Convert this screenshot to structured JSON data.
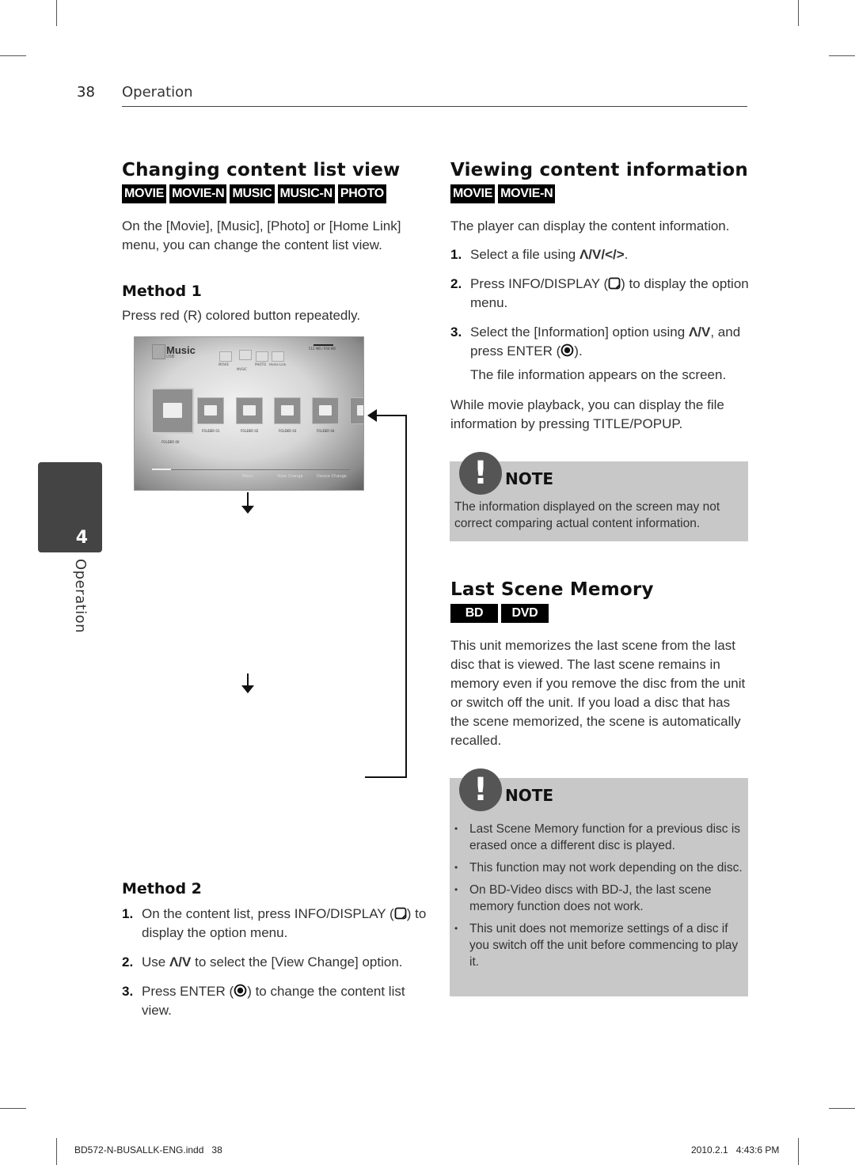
{
  "header": {
    "page_number": "38",
    "section": "Operation"
  },
  "side_tab": {
    "chapter_number": "4",
    "label": "Operation"
  },
  "left": {
    "title": "Changing content list view",
    "badges": [
      "MOVIE",
      "MOVIE-N",
      "MUSIC",
      "MUSIC-N",
      "PHOTO"
    ],
    "intro": "On the [Movie], [Music], [Photo] or [Home Link] menu, you can change the content list view.",
    "method1": {
      "heading": "Method 1",
      "text": "Press red (R) colored button repeatedly."
    },
    "screenshot": {
      "title": "Music",
      "subtitle": "USB",
      "categories": [
        "MOVIE",
        "MUSIC",
        "PHOTO",
        "Home Link"
      ],
      "capacity": "512 MB / 958 MB",
      "folders": [
        "FOLDER 00",
        "FOLDER 01",
        "FOLDER 02",
        "FOLDER 03",
        "FOLDER 04"
      ],
      "hints": [
        "Menu",
        "View Change",
        "Device Change"
      ]
    },
    "method2": {
      "heading": "Method 2",
      "steps": [
        {
          "num": "1.",
          "pre": "On the content list, press INFO/DISPLAY (",
          "post": ") to display the option menu."
        },
        {
          "num": "2.",
          "pre": "Use ",
          "keys": "Λ/V",
          "post": " to select the [View Change] option."
        },
        {
          "num": "3.",
          "pre": "Press ENTER (",
          "post": ") to change the content list view."
        }
      ]
    }
  },
  "right": {
    "info": {
      "title": "Viewing content information",
      "badges": [
        "MOVIE",
        "MOVIE-N"
      ],
      "intro": "The player can display the content information.",
      "steps": [
        {
          "num": "1.",
          "pre": "Select a file using ",
          "keys": "Λ/V/</>",
          "post": "."
        },
        {
          "num": "2.",
          "pre": "Press INFO/DISPLAY (",
          "post": ") to display the option menu."
        },
        {
          "num": "3.",
          "pre": "Select the [Information] option using ",
          "keys": "Λ/V",
          "mid": ", and press ENTER (",
          "post": ").",
          "sub": "The file information appears on the screen."
        }
      ],
      "outro": "While movie playback, you can display the file information by pressing TITLE/POPUP."
    },
    "note1": {
      "label": "NOTE",
      "text": "The information displayed on the screen may not correct comparing actual content information."
    },
    "memory": {
      "title": "Last Scene Memory",
      "badges": [
        "BD",
        "DVD"
      ],
      "text": "This unit memorizes the last scene from the last disc that is viewed. The last scene remains in memory even if you remove the disc from the unit or switch off the unit. If you load a disc that has the scene memorized, the scene is automatically recalled."
    },
    "note2": {
      "label": "NOTE",
      "items": [
        "Last Scene Memory function for a previous disc is erased once a different disc is played.",
        "This function may not work depending on the disc.",
        "On BD-Video discs with BD-J, the last scene memory function does not work.",
        "This unit does not memorize settings of a disc if you switch off the unit before commencing to play it."
      ]
    }
  },
  "footer": {
    "file": "BD572-N-BUSALLK-ENG.indd   38",
    "timestamp": "2010.2.1   4:43:6 PM"
  }
}
